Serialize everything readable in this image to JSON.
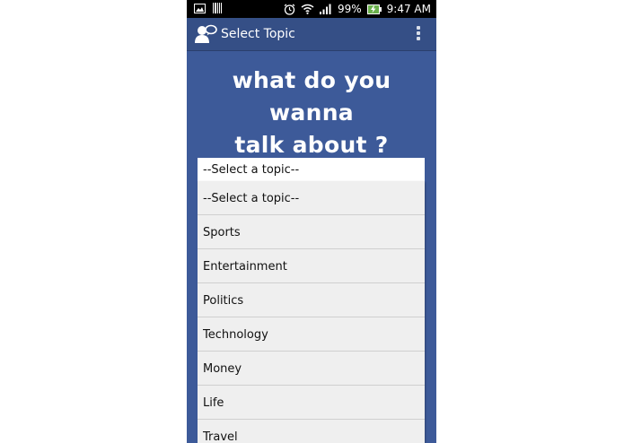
{
  "status_bar": {
    "battery": "99%",
    "time": "9:47 AM"
  },
  "action_bar": {
    "title": "Select Topic"
  },
  "headline": {
    "line1": "what do you wanna",
    "line2": "talk about ?"
  },
  "spinner": {
    "selected": "--Select a topic--"
  },
  "dropdown": {
    "items": [
      "--Select a topic--",
      "Sports",
      "Entertainment",
      "Politics",
      "Technology",
      "Money",
      "Life",
      "Travel"
    ]
  },
  "colors": {
    "background": "#3d5a99",
    "action_bar": "#354f86",
    "dropdown": "#efefef"
  }
}
